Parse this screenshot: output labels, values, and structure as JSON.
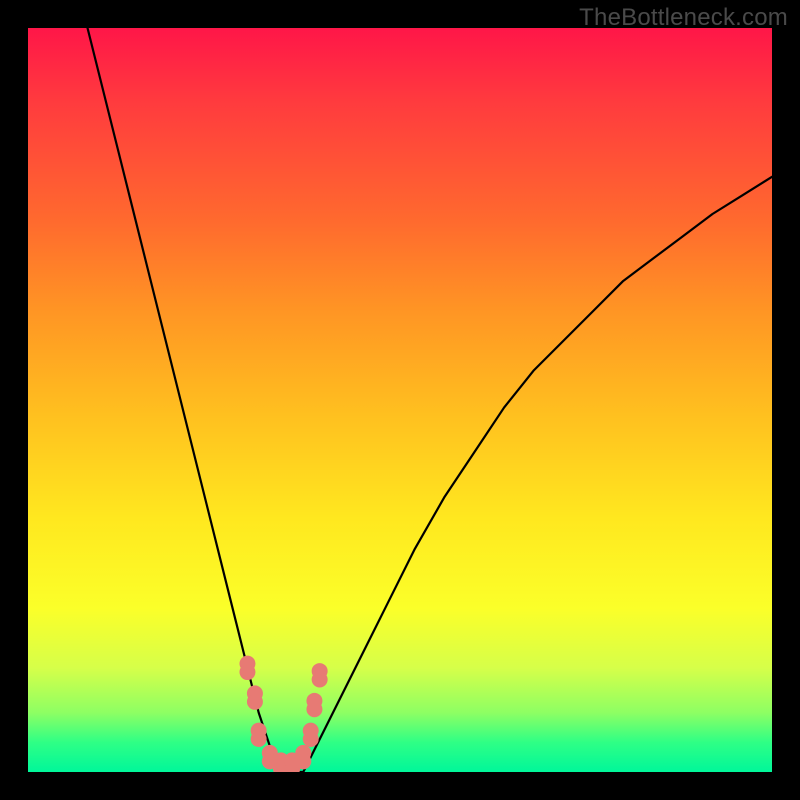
{
  "watermark": "TheBottleneck.com",
  "colors": {
    "background_frame": "#000000",
    "gradient_top": "#ff1648",
    "gradient_bottom": "#00f79a",
    "curve": "#000000",
    "markers": "#e77a74"
  },
  "chart_data": {
    "type": "line",
    "title": "",
    "xlabel": "",
    "ylabel": "",
    "xlim": [
      0,
      100
    ],
    "ylim": [
      0,
      100
    ],
    "grid": false,
    "legend": false,
    "series": [
      {
        "name": "curve",
        "x": [
          8,
          10,
          12,
          14,
          16,
          18,
          20,
          22,
          24,
          26,
          28,
          29,
          30,
          31,
          32,
          33,
          34,
          35,
          36,
          37,
          38,
          40,
          44,
          48,
          52,
          56,
          60,
          64,
          68,
          72,
          76,
          80,
          84,
          88,
          92,
          96,
          100
        ],
        "y": [
          100,
          92,
          84,
          76,
          68,
          60,
          52,
          44,
          36,
          28,
          20,
          16,
          12,
          8,
          5,
          2,
          0,
          0,
          0,
          0,
          2,
          6,
          14,
          22,
          30,
          37,
          43,
          49,
          54,
          58,
          62,
          66,
          69,
          72,
          75,
          77.5,
          80
        ]
      }
    ],
    "markers": {
      "name": "highlighted-points",
      "x": [
        29.5,
        30.5,
        31.0,
        32.5,
        34.0,
        35.5,
        37.0,
        38.0,
        38.5,
        39.2
      ],
      "y": [
        14.0,
        10.0,
        5.0,
        2.0,
        1.0,
        1.0,
        2.0,
        5.0,
        9.0,
        13.0
      ],
      "style": "double-lobe"
    }
  }
}
